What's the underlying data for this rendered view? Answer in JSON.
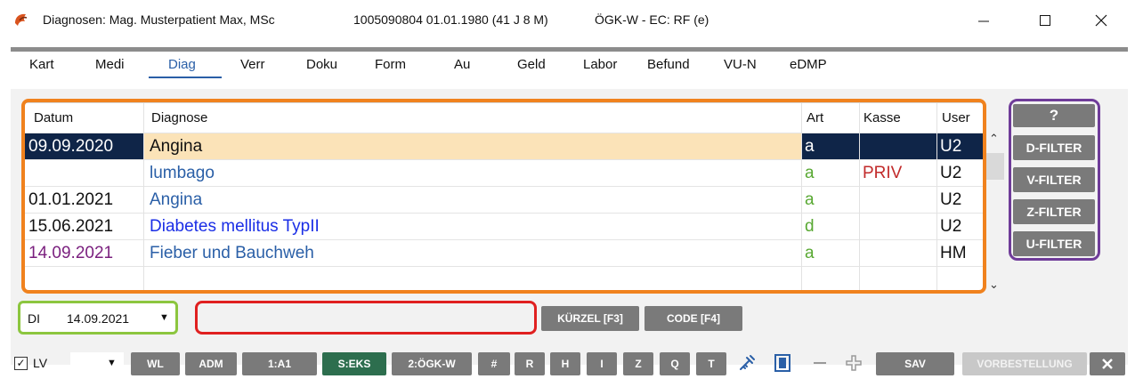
{
  "window": {
    "title": "Diagnosen: Mag. Musterpatient Max, MSc",
    "patient_info": "1005090804 01.01.1980 (41 J 8 M)",
    "insurance": "ÖGK-W - EC: RF (e)"
  },
  "tabs": [
    "Kart",
    "Medi",
    "Diag",
    "Verr",
    "Doku",
    "Form",
    "Au",
    "Geld",
    "Labor",
    "Befund",
    "VU-N",
    "eDMP"
  ],
  "active_tab": "Diag",
  "grid": {
    "columns": [
      "Datum",
      "Diagnose",
      "Art",
      "Kasse",
      "User"
    ],
    "rows": [
      {
        "datum": "09.09.2020",
        "diagnose": "Angina",
        "art": "a",
        "kasse": "",
        "user": "U2"
      },
      {
        "datum": "",
        "diagnose": "lumbago",
        "art": "a",
        "kasse": "PRIV",
        "user": "U2"
      },
      {
        "datum": "01.01.2021",
        "diagnose": "Angina",
        "art": "a",
        "kasse": "",
        "user": "U2"
      },
      {
        "datum": "15.06.2021",
        "diagnose": "Diabetes mellitus TypII",
        "art": "d",
        "kasse": "",
        "user": "U2"
      },
      {
        "datum": "14.09.2021",
        "diagnose": "Fieber und Bauchweh",
        "art": "a",
        "kasse": "",
        "user": "HM"
      }
    ]
  },
  "filters": {
    "help": "?",
    "buttons": [
      "D-FILTER",
      "V-FILTER",
      "Z-FILTER",
      "U-FILTER"
    ]
  },
  "entry": {
    "di_label": "DI",
    "di_date": "14.09.2021",
    "text_value": "",
    "kuerzel_button": "KÜRZEL [F3]",
    "code_button": "CODE [F4]"
  },
  "bottom": {
    "checkbox_label": "LV",
    "checkbox_checked": true,
    "buttons": [
      "WL",
      "ADM",
      "1:A1",
      "S:EKS",
      "2:ÖGK-W",
      "#",
      "R",
      "H",
      "I",
      "Z",
      "Q",
      "T"
    ],
    "sav": "SAV",
    "vorbestellung": "VORBESTELLUNG"
  },
  "colors": {
    "selection_bg": "#0f2548",
    "selected_row": "#fbe3b8",
    "link_blue": "#2a5fa7",
    "bright_blue": "#1a2ee6",
    "purple": "#7a1f7e",
    "green": "#58a832",
    "red": "#c22b2b"
  }
}
